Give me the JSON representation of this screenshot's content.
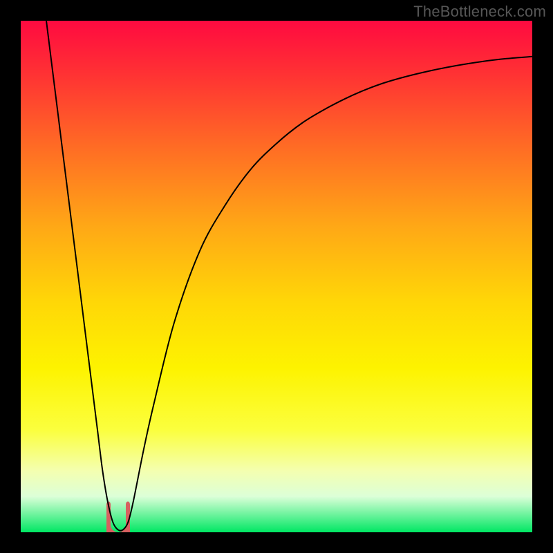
{
  "watermark": "TheBottleneck.com",
  "chart_data": {
    "type": "line",
    "title": "",
    "xlabel": "",
    "ylabel": "",
    "xlim": [
      0,
      100
    ],
    "ylim": [
      0,
      100
    ],
    "annotations": [],
    "series": [
      {
        "name": "curve",
        "x": [
          5,
          6,
          8,
          10,
          12,
          14,
          15,
          16,
          17,
          18,
          19,
          20,
          21,
          22,
          24,
          26,
          30,
          35,
          40,
          45,
          50,
          55,
          60,
          65,
          70,
          75,
          80,
          85,
          90,
          95,
          100
        ],
        "values": [
          100,
          92,
          76,
          60,
          44,
          28,
          20,
          12,
          6,
          2,
          0.5,
          0.5,
          2,
          6,
          16,
          25,
          41,
          55,
          64,
          71,
          76,
          80,
          83,
          85.5,
          87.5,
          89,
          90.2,
          91.2,
          92,
          92.6,
          93
        ]
      }
    ],
    "gradient_bands": [
      {
        "color": "#ff0a40",
        "stop": 0
      },
      {
        "color": "#ffd707",
        "stop": 55
      },
      {
        "color": "#fbff3e",
        "stop": 80
      },
      {
        "color": "#00e763",
        "stop": 100
      }
    ],
    "marker_region": {
      "x_center": 19,
      "width": 3.5,
      "note": "salmon U-shaped markers at curve minimum"
    }
  }
}
